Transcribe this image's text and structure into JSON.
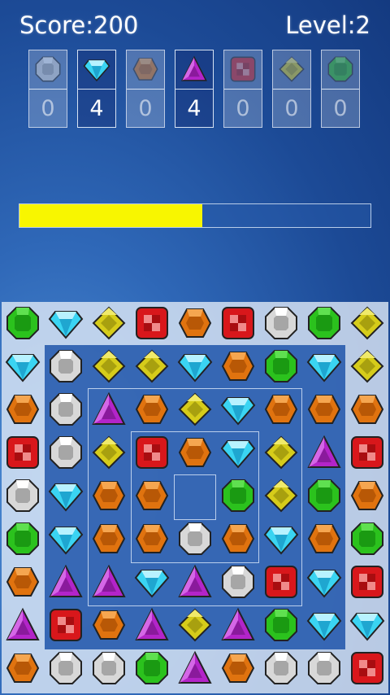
{
  "hud": {
    "score": "Score:200",
    "level": "Level:2"
  },
  "goals": [
    {
      "gem": "white",
      "count": "0",
      "active": false
    },
    {
      "gem": "cyan",
      "count": "4",
      "active": true
    },
    {
      "gem": "orange",
      "count": "0",
      "active": false
    },
    {
      "gem": "purple",
      "count": "4",
      "active": true
    },
    {
      "gem": "red",
      "count": "0",
      "active": false
    },
    {
      "gem": "yellow",
      "count": "0",
      "active": false
    },
    {
      "gem": "green",
      "count": "0",
      "active": false
    }
  ],
  "progress": {
    "fraction": 0.52,
    "color": "#f8f600"
  },
  "board": {
    "rows": [
      [
        "green",
        "cyan",
        "yellow",
        "red",
        "orange",
        "red",
        "white",
        "green",
        "yellow"
      ],
      [
        "cyan",
        "white",
        "yellow",
        "yellow",
        "cyan",
        "orange",
        "green",
        "cyan",
        "yellow"
      ],
      [
        "orange",
        "white",
        "purple",
        "orange",
        "yellow",
        "cyan",
        "orange",
        "orange",
        "orange"
      ],
      [
        "red",
        "white",
        "yellow",
        "red",
        "orange",
        "cyan",
        "yellow",
        "purple",
        "red"
      ],
      [
        "white",
        "cyan",
        "orange",
        "orange",
        "",
        "green",
        "yellow",
        "green",
        "orange"
      ],
      [
        "green",
        "cyan",
        "orange",
        "orange",
        "white",
        "orange",
        "cyan",
        "orange",
        "green"
      ],
      [
        "orange",
        "purple",
        "purple",
        "cyan",
        "purple",
        "white",
        "red",
        "cyan",
        "red"
      ],
      [
        "purple",
        "red",
        "orange",
        "purple",
        "yellow",
        "purple",
        "green",
        "cyan",
        "cyan"
      ],
      [
        "orange",
        "white",
        "white",
        "green",
        "purple",
        "orange",
        "white",
        "white",
        "red"
      ]
    ]
  },
  "gem_colors": {
    "green": "#2bc21d",
    "cyan": "#3ad4f2",
    "yellow": "#d6cc1a",
    "red": "#d8171b",
    "orange": "#e0730f",
    "white": "#d8d8d8",
    "purple": "#b324c9"
  }
}
